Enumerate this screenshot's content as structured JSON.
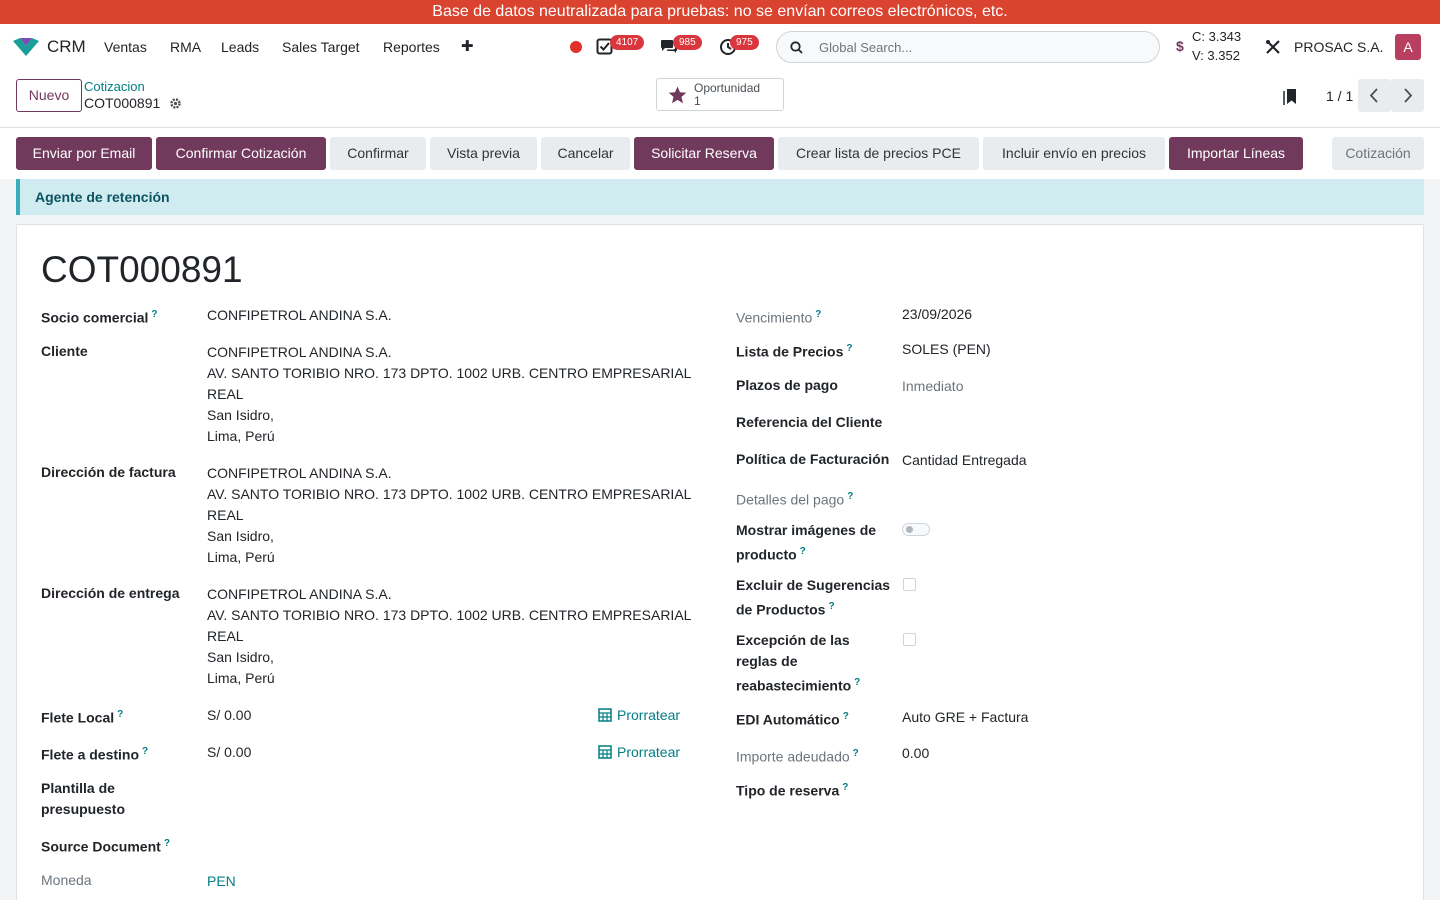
{
  "banner": "Base de datos neutralizada para pruebas: no se envían correos electrónicos, etc.",
  "navbar": {
    "app_name": "CRM",
    "menu": [
      "Ventas",
      "RMA",
      "Leads",
      "Sales Target",
      "Reportes"
    ],
    "add_symbol": "✚",
    "activities_count": "4107",
    "messages_count": "985",
    "timer_count": "975",
    "search_placeholder": "Global Search...",
    "currency_symbol": "$",
    "rate_buy": "C: 3.343",
    "rate_sell": "V: 3.352",
    "company": "PROSAC S.A.",
    "avatar_letter": "A"
  },
  "control_panel": {
    "new_label": "Nuevo",
    "breadcrumb_parent": "Cotizacion",
    "record_name": "COT000891",
    "smart_button_label": "Oportunidad",
    "smart_button_count": "1",
    "pager": "1 / 1"
  },
  "actions": {
    "buttons": [
      "Enviar por Email",
      "Confirmar Cotización",
      "Confirmar",
      "Vista previa",
      "Cancelar",
      "Solicitar Reserva",
      "Crear lista de precios PCE",
      "Incluir envío en precios",
      "Importar Líneas"
    ],
    "status": "Cotización"
  },
  "alert": "Agente de retención",
  "form": {
    "title": "COT000891",
    "left": {
      "socio_label": "Socio comercial",
      "socio_value": "CONFIPETROL ANDINA S.A.",
      "cliente_label": "Cliente",
      "cliente_lines": [
        "CONFIPETROL ANDINA S.A.",
        "AV. SANTO TORIBIO NRO. 173 DPTO. 1002 URB. CENTRO EMPRESARIAL",
        "REAL",
        "San Isidro,",
        "Lima, Perú"
      ],
      "factura_label": "Dirección de factura",
      "factura_lines": [
        "CONFIPETROL ANDINA S.A.",
        "AV. SANTO TORIBIO NRO. 173 DPTO. 1002 URB. CENTRO EMPRESARIAL",
        "REAL",
        "San Isidro,",
        "Lima, Perú"
      ],
      "entrega_label": "Dirección de entrega",
      "entrega_lines": [
        "CONFIPETROL ANDINA S.A.",
        "AV. SANTO TORIBIO NRO. 173 DPTO. 1002 URB. CENTRO EMPRESARIAL",
        "REAL",
        "San Isidro,",
        "Lima, Perú"
      ],
      "flete_local_label": "Flete Local",
      "flete_local_value": "S/ 0.00",
      "flete_destino_label": "Flete a destino",
      "flete_destino_value": "S/ 0.00",
      "prorratear": "Prorratear",
      "plantilla_label_1": "Plantilla de",
      "plantilla_label_2": "presupuesto",
      "source_label": "Source Document",
      "moneda_label": "Moneda",
      "moneda_value": "PEN"
    },
    "right": {
      "vencimiento_label": "Vencimiento",
      "vencimiento_value": "23/09/2026",
      "lista_label": "Lista de Precios",
      "lista_value": "SOLES (PEN)",
      "plazos_label": "Plazos de pago",
      "plazos_value": "Inmediato",
      "referencia_label": "Referencia del Cliente",
      "politica_label": "Política de Facturación",
      "politica_value": "Cantidad Entregada",
      "detalles_label": "Detalles del pago",
      "mostrar_label_1": "Mostrar imágenes de",
      "mostrar_label_2": "producto",
      "excluir_label_1": "Excluir de Sugerencias",
      "excluir_label_2": "de Productos",
      "excepcion_label_1": "Excepción de las",
      "excepcion_label_2": "reglas de",
      "excepcion_label_3": "reabastecimiento",
      "edi_label": "EDI Automático",
      "edi_value": "Auto GRE + Factura",
      "importe_label": "Importe adeudado",
      "importe_value": "0.00",
      "tipo_label": "Tipo de reserva"
    },
    "help_mark": "?"
  }
}
